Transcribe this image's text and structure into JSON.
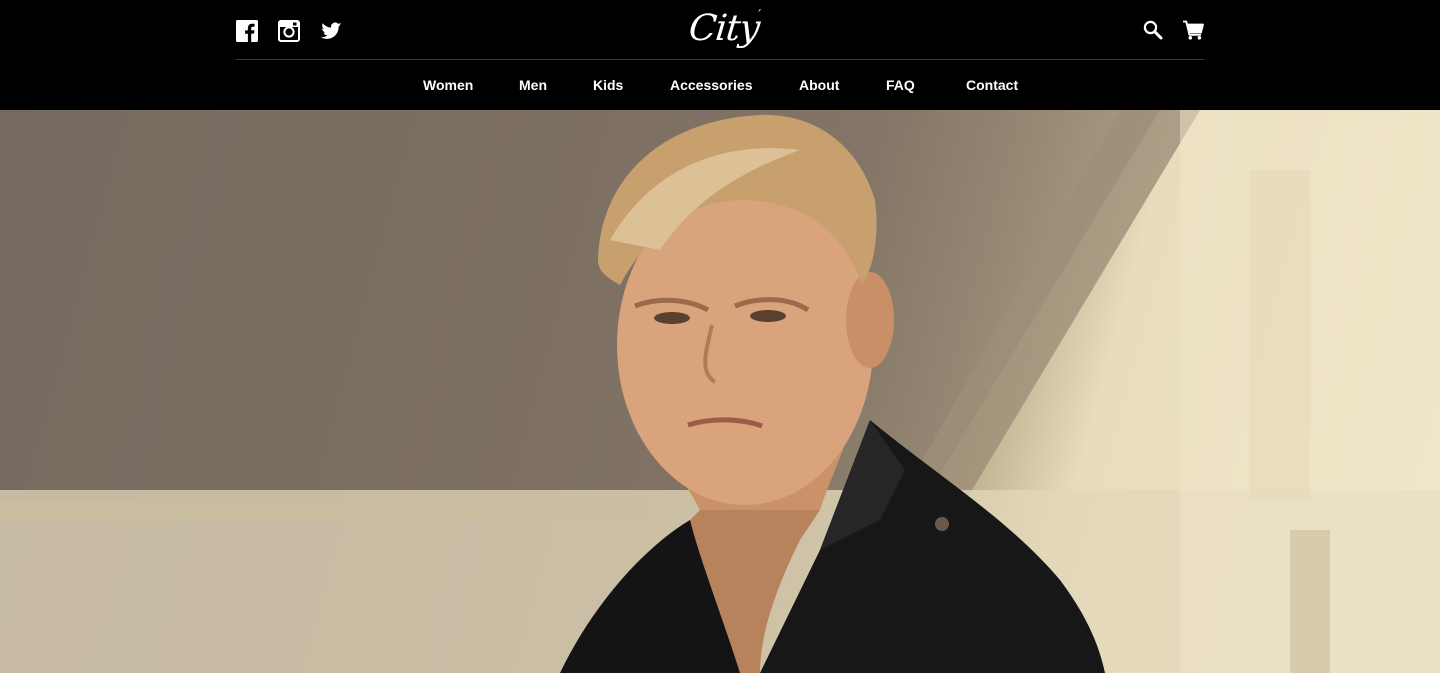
{
  "brand": {
    "logo_text": "City",
    "logo_mark": "´"
  },
  "social": [
    {
      "name": "facebook",
      "icon": "facebook-icon"
    },
    {
      "name": "instagram",
      "icon": "instagram-icon"
    },
    {
      "name": "twitter",
      "icon": "twitter-icon"
    }
  ],
  "tools": {
    "search_icon": "search-icon",
    "cart_icon": "cart-icon"
  },
  "nav": {
    "items": [
      {
        "label": "Women"
      },
      {
        "label": "Men"
      },
      {
        "label": "Kids"
      },
      {
        "label": "Accessories"
      },
      {
        "label": "About"
      },
      {
        "label": "FAQ"
      },
      {
        "label": "Contact"
      }
    ]
  },
  "colors": {
    "header_bg": "#000000",
    "text": "#ffffff",
    "divider": "#3a3a3a"
  }
}
